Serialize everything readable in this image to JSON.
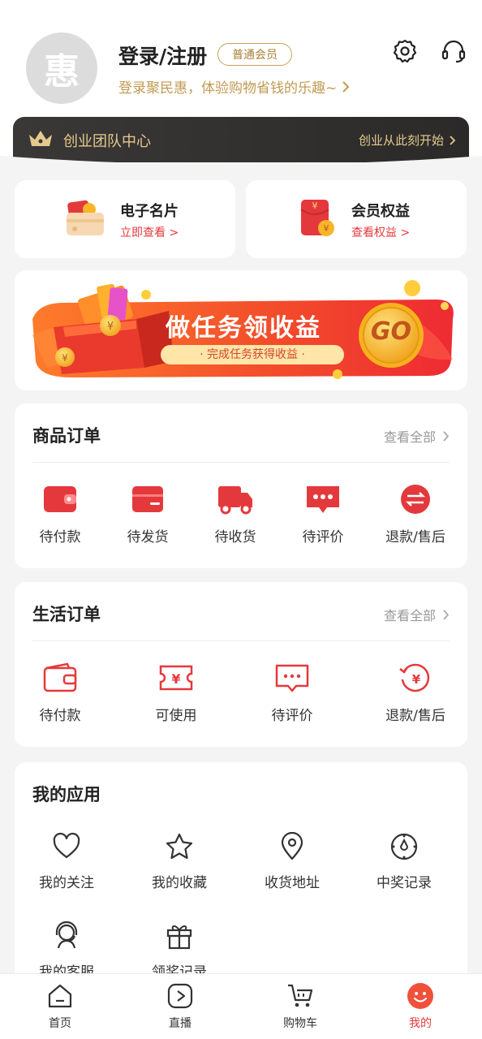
{
  "header": {
    "avatar_char": "惠",
    "login_title": "登录/注册",
    "member_badge": "普通会员",
    "login_sub": "登录聚民惠，体验购物省钱的乐趣~",
    "team_title": "创业团队中心",
    "team_link": "创业从此刻开始"
  },
  "cards": {
    "business_card": {
      "title": "电子名片",
      "link": "立即查看 >"
    },
    "member_rights": {
      "title": "会员权益",
      "link": "查看权益 >"
    }
  },
  "banner": {
    "title": "做任务领收益",
    "subtitle": "· 完成任务获得收益 ·",
    "go": "GO"
  },
  "product_orders": {
    "title": "商品订单",
    "view_all": "查看全部",
    "items": [
      {
        "label": "待付款",
        "icon": "wallet-icon"
      },
      {
        "label": "待发货",
        "icon": "package-icon"
      },
      {
        "label": "待收货",
        "icon": "truck-icon"
      },
      {
        "label": "待评价",
        "icon": "comment-icon"
      },
      {
        "label": "退款/售后",
        "icon": "refund-icon"
      }
    ]
  },
  "life_orders": {
    "title": "生活订单",
    "view_all": "查看全部",
    "items": [
      {
        "label": "待付款",
        "icon": "wallet-icon"
      },
      {
        "label": "可使用",
        "icon": "ticket-icon"
      },
      {
        "label": "待评价",
        "icon": "comment-icon"
      },
      {
        "label": "退款/售后",
        "icon": "refund-icon"
      }
    ]
  },
  "my_apps": {
    "title": "我的应用",
    "items": [
      {
        "label": "我的关注",
        "icon": "heart-icon"
      },
      {
        "label": "我的收藏",
        "icon": "star-icon"
      },
      {
        "label": "收货地址",
        "icon": "location-icon"
      },
      {
        "label": "中奖记录",
        "icon": "prize-icon"
      },
      {
        "label": "我的客服",
        "icon": "service-icon"
      },
      {
        "label": "领奖记录",
        "icon": "gift-icon"
      }
    ]
  },
  "bottom_nav": [
    {
      "label": "首页",
      "icon": "home-icon"
    },
    {
      "label": "直播",
      "icon": "live-icon"
    },
    {
      "label": "购物车",
      "icon": "cart-icon"
    },
    {
      "label": "我的",
      "icon": "profile-icon",
      "active": true
    }
  ],
  "colors": {
    "accent": "#e4393c",
    "gold": "#c19a52",
    "background": "#f4f4f4"
  }
}
